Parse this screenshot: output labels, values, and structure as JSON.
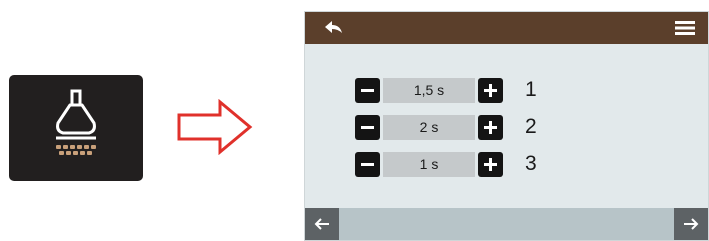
{
  "icons": {
    "tile": "cleaning-brush-icon",
    "arrow": "arrow-right-icon",
    "back": "return-icon",
    "menu": "menu-icon",
    "minus": "minus-icon",
    "plus": "plus-icon",
    "prev": "arrow-left-icon",
    "next": "arrow-right-icon"
  },
  "colors": {
    "tile_bg": "#221f1f",
    "brush_bristles": "#c9a07a",
    "arrow_outline": "#e0312b",
    "top_bar": "#5b3f2b",
    "screen_bg": "#e2e9eb",
    "value_bg": "#c5c9cb",
    "bottom_bar": "#b7c4c8",
    "nav_button": "#5d6265"
  },
  "rows": [
    {
      "value": "1,5 s",
      "index": "1"
    },
    {
      "value": "2 s",
      "index": "2"
    },
    {
      "value": "1 s",
      "index": "3"
    }
  ]
}
